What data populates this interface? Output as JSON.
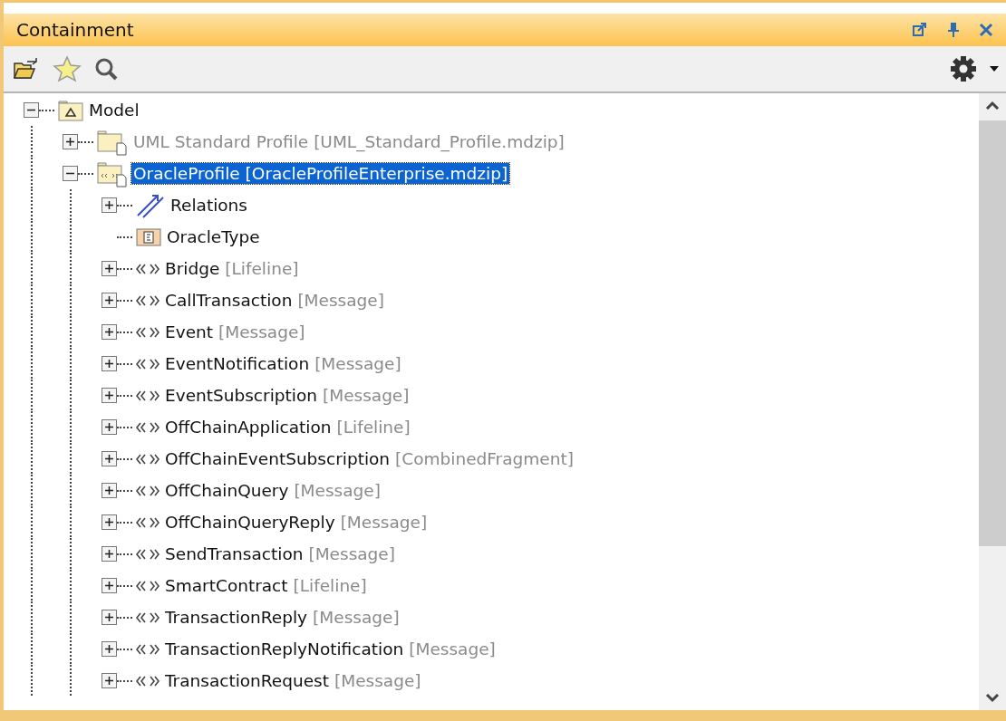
{
  "panel": {
    "title": "Containment"
  },
  "tree": [
    {
      "kind": "model",
      "name": "Model",
      "expanded": true,
      "selected": false,
      "children": [
        {
          "kind": "profile",
          "name": "UML Standard Profile [UML_Standard_Profile.mdzip]",
          "expanded": false,
          "dimmed": true,
          "selected": false
        },
        {
          "kind": "profile",
          "name": "OracleProfile [OracleProfileEnterprise.mdzip]",
          "expanded": true,
          "dimmed": false,
          "selected": true,
          "children": [
            {
              "kind": "relations",
              "name": "Relations",
              "expanded": false,
              "selected": false
            },
            {
              "kind": "enumeration",
              "name": "OracleType",
              "selected": false
            },
            {
              "kind": "stereotype",
              "name": "Bridge",
              "meta": "[Lifeline]",
              "expanded": false,
              "selected": false
            },
            {
              "kind": "stereotype",
              "name": "CallTransaction",
              "meta": "[Message]",
              "expanded": false,
              "selected": false
            },
            {
              "kind": "stereotype",
              "name": "Event",
              "meta": "[Message]",
              "expanded": false,
              "selected": false
            },
            {
              "kind": "stereotype",
              "name": "EventNotification",
              "meta": "[Message]",
              "expanded": false,
              "selected": false
            },
            {
              "kind": "stereotype",
              "name": "EventSubscription",
              "meta": "[Message]",
              "expanded": false,
              "selected": false
            },
            {
              "kind": "stereotype",
              "name": "OffChainApplication",
              "meta": "[Lifeline]",
              "expanded": false,
              "selected": false
            },
            {
              "kind": "stereotype",
              "name": "OffChainEventSubscription",
              "meta": "[CombinedFragment]",
              "expanded": false,
              "selected": false
            },
            {
              "kind": "stereotype",
              "name": "OffChainQuery",
              "meta": "[Message]",
              "expanded": false,
              "selected": false
            },
            {
              "kind": "stereotype",
              "name": "OffChainQueryReply",
              "meta": "[Message]",
              "expanded": false,
              "selected": false
            },
            {
              "kind": "stereotype",
              "name": "SendTransaction",
              "meta": "[Message]",
              "expanded": false,
              "selected": false
            },
            {
              "kind": "stereotype",
              "name": "SmartContract",
              "meta": "[Lifeline]",
              "expanded": false,
              "selected": false
            },
            {
              "kind": "stereotype",
              "name": "TransactionReply",
              "meta": "[Message]",
              "expanded": false,
              "selected": false
            },
            {
              "kind": "stereotype",
              "name": "TransactionReplyNotification",
              "meta": "[Message]",
              "expanded": false,
              "selected": false
            },
            {
              "kind": "stereotype",
              "name": "TransactionRequest",
              "meta": "[Message]",
              "expanded": false,
              "selected": false
            }
          ]
        }
      ]
    }
  ]
}
